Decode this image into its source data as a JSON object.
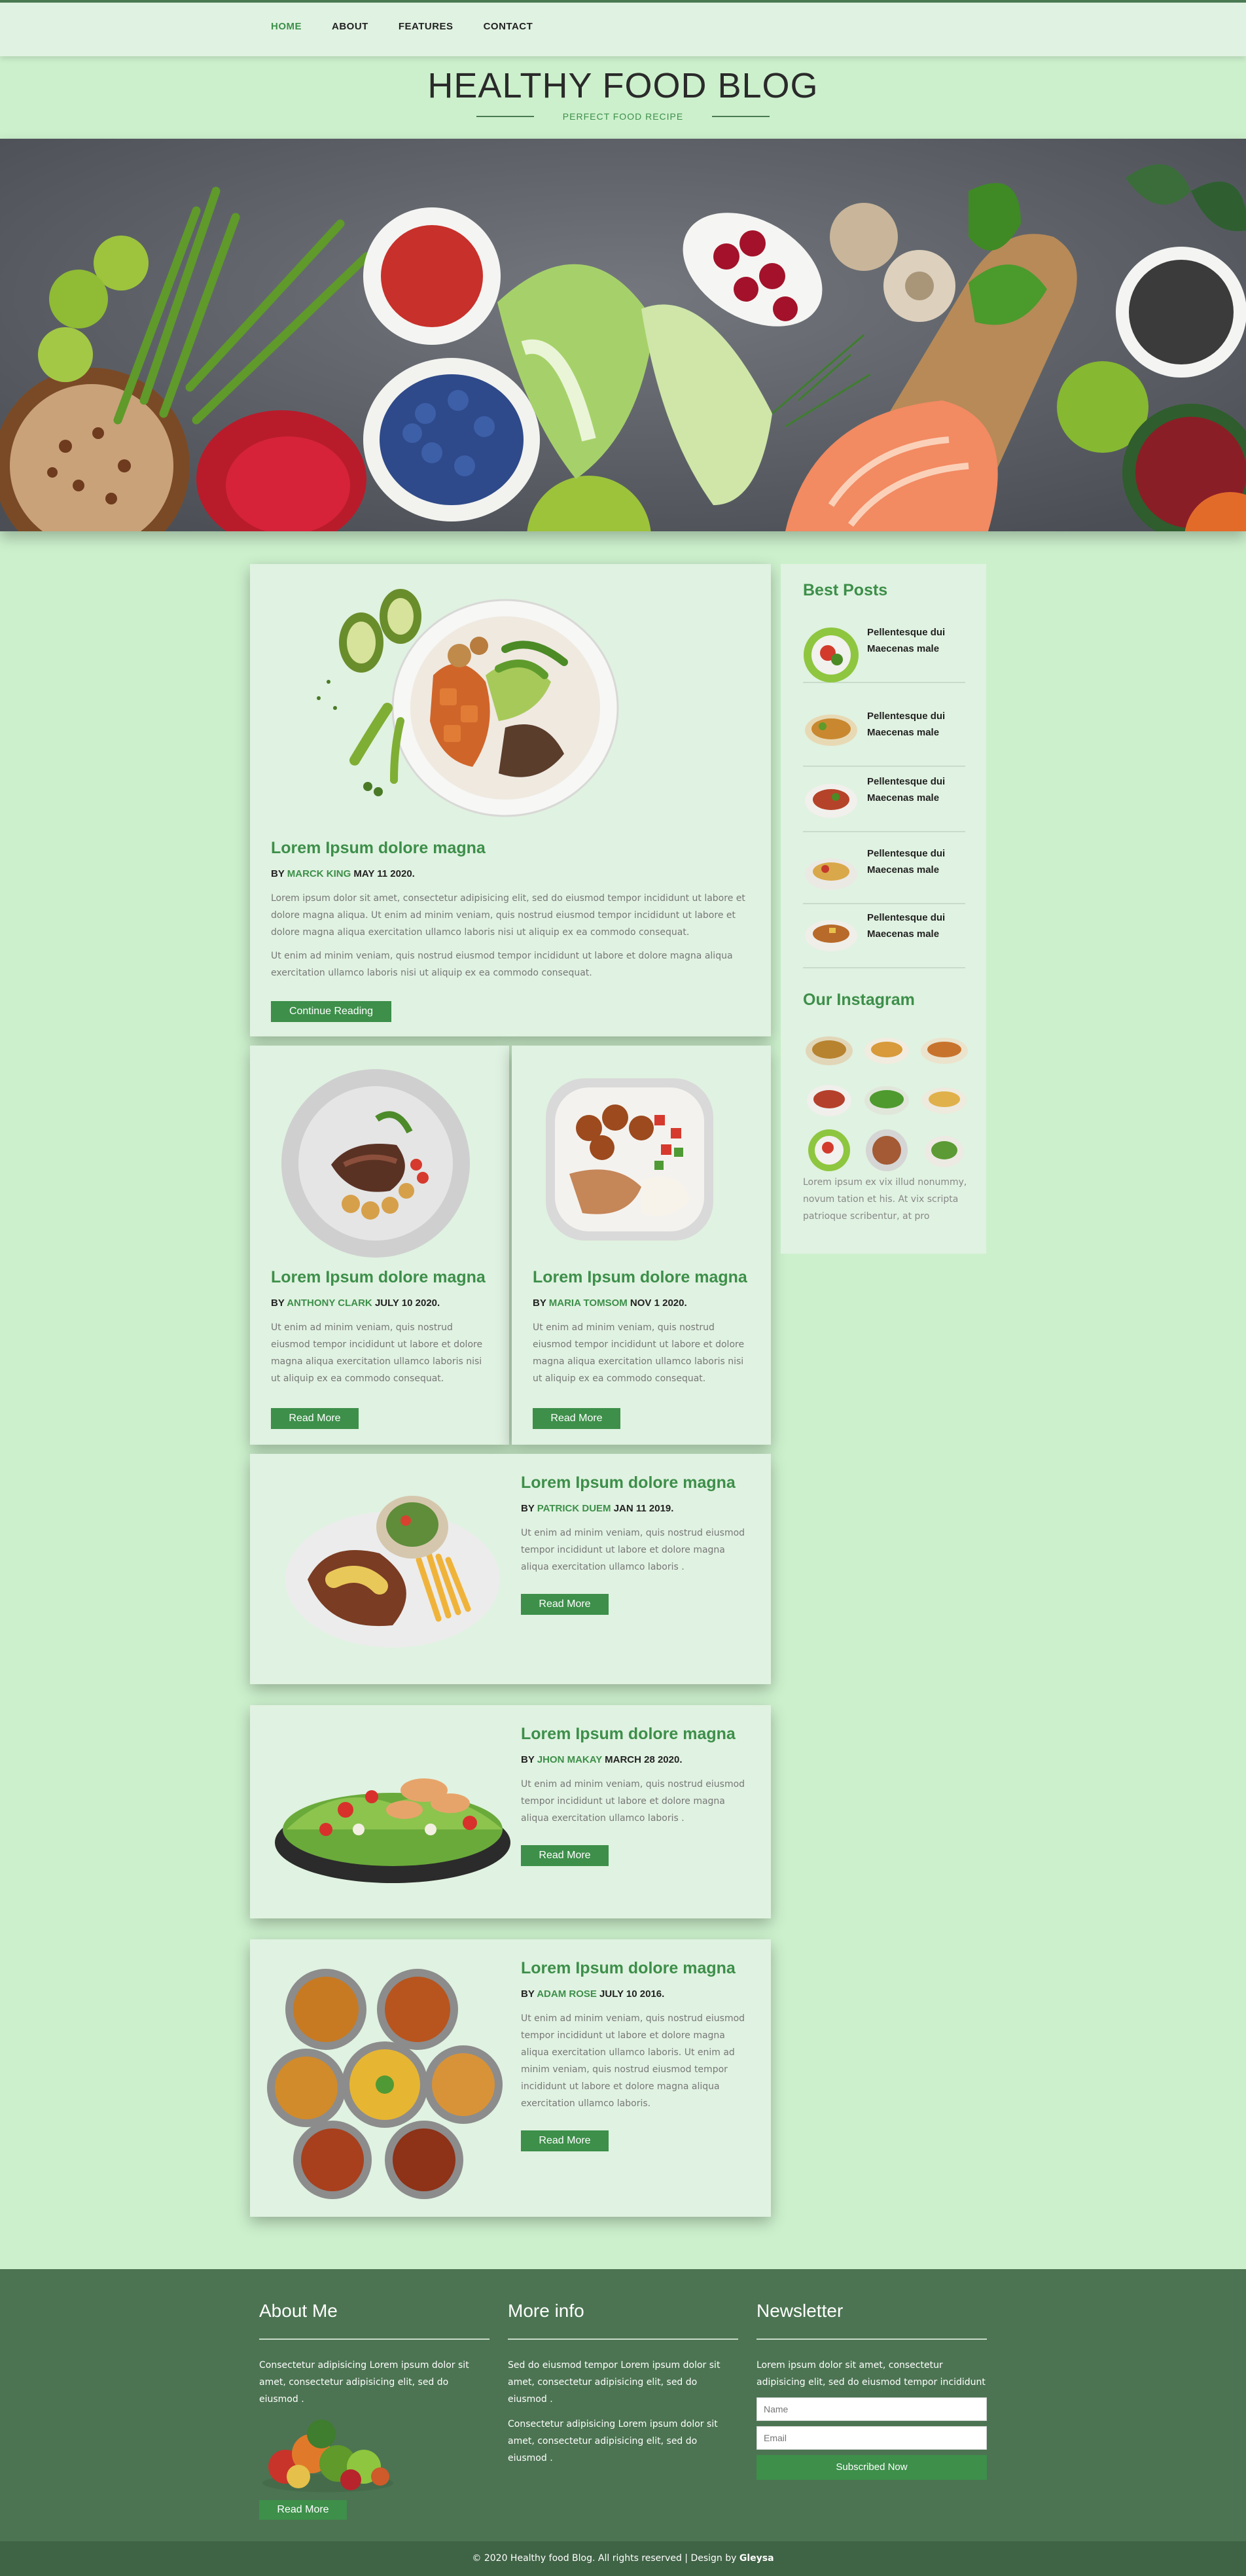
{
  "nav": {
    "items": [
      "HOME",
      "ABOUT",
      "FEATURES",
      "CONTACT"
    ],
    "active": "HOME"
  },
  "header": {
    "title": "HEALTHY FOOD BLOG",
    "tagline": "PERFECT FOOD RECIPE"
  },
  "featured_post": {
    "title": "Lorem Ipsum dolore magna",
    "by": "BY",
    "author": "MARCK KING",
    "date": "MAY 11 2020.",
    "p1": "Lorem ipsum dolor sit amet, consectetur adipisicing elit, sed do eiusmod tempor incididunt ut labore et dolore magna aliqua. Ut enim ad minim veniam, quis nostrud eiusmod tempor incididunt ut labore et dolore magna aliqua exercitation ullamco laboris nisi ut aliquip ex ea commodo consequat.",
    "p2": "Ut enim ad minim veniam, quis nostrud eiusmod tempor incididunt ut labore et dolore magna aliqua exercitation ullamco laboris nisi ut aliquip ex ea commodo consequat.",
    "button": "Continue Reading"
  },
  "posts": [
    {
      "title": "Lorem Ipsum dolore magna",
      "by": "BY",
      "author": "ANTHONY CLARK",
      "date": "JULY 10 2020.",
      "text": "Ut enim ad minim veniam, quis nostrud eiusmod tempor incididunt ut labore et dolore magna aliqua exercitation ullamco laboris nisi ut aliquip ex ea commodo consequat.",
      "button": "Read More"
    },
    {
      "title": "Lorem Ipsum dolore magna",
      "by": "BY",
      "author": "MARIA TOMSOM",
      "date": "NOV 1 2020.",
      "text": "Ut enim ad minim veniam, quis nostrud eiusmod tempor incididunt ut labore et dolore magna aliqua exercitation ullamco laboris nisi ut aliquip ex ea commodo consequat.",
      "button": "Read More"
    },
    {
      "title": "Lorem Ipsum dolore magna",
      "by": "BY",
      "author": "PATRICK DUEM",
      "date": "JAN 11 2019.",
      "text": "Ut enim ad minim veniam, quis nostrud eiusmod tempor incididunt ut labore et dolore magna aliqua exercitation ullamco laboris .",
      "button": "Read More"
    },
    {
      "title": "Lorem Ipsum dolore magna",
      "by": "BY",
      "author": "JHON MAKAY",
      "date": "MARCH 28 2020.",
      "text": "Ut enim ad minim veniam, quis nostrud eiusmod tempor incididunt ut labore et dolore magna aliqua exercitation ullamco laboris .",
      "button": "Read More"
    },
    {
      "title": "Lorem Ipsum dolore magna",
      "by": "BY",
      "author": "ADAM ROSE",
      "date": "JULY 10 2016.",
      "text": "Ut enim ad minim veniam, quis nostrud eiusmod tempor incididunt ut labore et dolore magna aliqua exercitation ullamco laboris. Ut enim ad minim veniam, quis nostrud eiusmod tempor incididunt ut labore et dolore magna aliqua exercitation ullamco laboris.",
      "button": "Read More"
    }
  ],
  "sidebar": {
    "best_posts_heading": "Best Posts",
    "best_posts": [
      {
        "line1": "Pellentesque dui",
        "line2": "Maecenas male"
      },
      {
        "line1": "Pellentesque dui",
        "line2": "Maecenas male"
      },
      {
        "line1": "Pellentesque dui",
        "line2": "Maecenas male"
      },
      {
        "line1": "Pellentesque dui",
        "line2": "Maecenas male"
      },
      {
        "line1": "Pellentesque dui",
        "line2": "Maecenas male"
      }
    ],
    "instagram_heading": "Our Instagram",
    "instagram_text": "Lorem ipsum ex vix illud nonummy, novum tation et his. At vix scripta patrioque scribentur, at pro"
  },
  "footer": {
    "about": {
      "heading": "About Me",
      "text": "Consectetur adipisicing Lorem ipsum dolor sit amet, consectetur adipisicing elit, sed do eiusmod .",
      "button": "Read More"
    },
    "more_info": {
      "heading": "More info",
      "p1": "Sed do eiusmod tempor Lorem ipsum dolor sit amet, consectetur adipisicing elit, sed do eiusmod .",
      "p2": "Consectetur adipisicing Lorem ipsum dolor sit amet, consectetur adipisicing elit, sed do eiusmod ."
    },
    "newsletter": {
      "heading": "Newsletter",
      "text": "Lorem ipsum dolor sit amet, consectetur adipisicing elit, sed do eiusmod tempor incididunt",
      "name_placeholder": "Name",
      "email_placeholder": "Email",
      "button": "Subscribed Now"
    },
    "copyright": "© 2020 Healthy food Blog. All rights reserved | Design by",
    "designer": "Gleysa"
  },
  "colors": {
    "accent": "#3d8f4a",
    "page_bg": "#ccf0cc",
    "card_bg": "#e0f2e1",
    "footer_bg": "#4c7452"
  }
}
